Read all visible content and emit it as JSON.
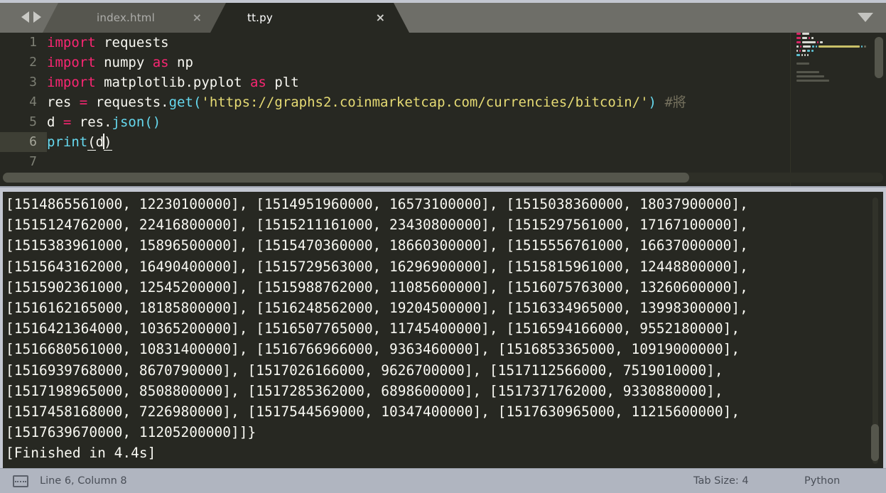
{
  "window": {
    "app": "Sublime Text",
    "theme_bg": "#272822",
    "chrome_bg": "#c3c7d1",
    "tabbar_bg": "#6e6e68"
  },
  "tabbar": {
    "nav_prev_icon": "triangle-left-icon",
    "nav_next_icon": "triangle-right-icon",
    "overflow_icon": "chevron-down-icon",
    "tabs": [
      {
        "label": "index.html",
        "active": false,
        "close_glyph": "×"
      },
      {
        "label": "tt.py",
        "active": true,
        "close_glyph": "×"
      }
    ]
  },
  "editor": {
    "language": "Python",
    "active_line": 6,
    "lines": [
      {
        "num": "1",
        "tokens": [
          {
            "t": "import",
            "c": "kw"
          },
          {
            "t": " requests",
            "c": "plain"
          }
        ]
      },
      {
        "num": "2",
        "tokens": [
          {
            "t": "import",
            "c": "kw"
          },
          {
            "t": " numpy ",
            "c": "plain"
          },
          {
            "t": "as",
            "c": "kw"
          },
          {
            "t": " np",
            "c": "plain"
          }
        ]
      },
      {
        "num": "3",
        "tokens": [
          {
            "t": "import",
            "c": "kw"
          },
          {
            "t": " matplotlib.pyplot ",
            "c": "plain"
          },
          {
            "t": "as",
            "c": "kw"
          },
          {
            "t": " plt",
            "c": "plain"
          }
        ]
      },
      {
        "num": "4",
        "tokens": [
          {
            "t": "res ",
            "c": "plain"
          },
          {
            "t": "=",
            "c": "kw"
          },
          {
            "t": " requests.",
            "c": "plain"
          },
          {
            "t": "get",
            "c": "fn"
          },
          {
            "t": "(",
            "c": "fn"
          },
          {
            "t": "'https://graphs2.coinmarketcap.com/currencies/bitcoin/'",
            "c": "str"
          },
          {
            "t": ")",
            "c": "fn"
          },
          {
            "t": " #將",
            "c": "comment"
          }
        ]
      },
      {
        "num": "5",
        "tokens": [
          {
            "t": "d ",
            "c": "plain"
          },
          {
            "t": "=",
            "c": "kw"
          },
          {
            "t": " res.",
            "c": "plain"
          },
          {
            "t": "json",
            "c": "fn"
          },
          {
            "t": "()",
            "c": "fn"
          }
        ]
      },
      {
        "num": "6",
        "tokens": [
          {
            "t": "print",
            "c": "fn"
          },
          {
            "t": "(",
            "c": "brk"
          },
          {
            "t": "d",
            "c": "plain"
          },
          {
            "t": "CURSOR",
            "c": "caret"
          },
          {
            "t": ")",
            "c": "brk"
          }
        ]
      },
      {
        "num": "7",
        "tokens": []
      }
    ],
    "colors": {
      "keyword": "#f92672",
      "plain": "#f8f8f2",
      "function": "#66d9ef",
      "string": "#e6db74",
      "comment": "#75715e",
      "background": "#272822",
      "gutter_text": "#7d7f74",
      "active_gutter_bg": "#3e3f35"
    }
  },
  "output": {
    "lines": [
      "[1514865561000, 12230100000], [1514951960000, 16573100000], [1515038360000, 18037900000],",
      "[1515124762000, 22416800000], [1515211161000, 23430800000], [1515297561000, 17167100000],",
      "[1515383961000, 15896500000], [1515470360000, 18660300000], [1515556761000, 16637000000],",
      "[1515643162000, 16490400000], [1515729563000, 16296900000], [1515815961000, 12448800000],",
      "[1515902361000, 12545200000], [1515988762000, 11085600000], [1516075763000, 13260600000],",
      "[1516162165000, 18185800000], [1516248562000, 19204500000], [1516334965000, 13998300000],",
      "[1516421364000, 10365200000], [1516507765000, 11745400000], [1516594166000, 9552180000],",
      "[1516680561000, 10831400000], [1516766966000, 9363460000], [1516853365000, 10919000000],",
      "[1516939768000, 8670790000], [1517026166000, 9626700000], [1517112566000, 7519010000],",
      "[1517198965000, 8508800000], [1517285362000, 6898600000], [1517371762000, 9330880000],",
      "[1517458168000, 7226980000], [1517544569000, 10347400000], [1517630965000, 11215600000],",
      "[1517639670000, 11205200000]]}",
      "[Finished in 4.4s]"
    ]
  },
  "statusbar": {
    "panel_icon": "console-panel-icon",
    "line_column": "Line 6, Column 8",
    "tab_size": "Tab Size: 4",
    "language": "Python"
  }
}
